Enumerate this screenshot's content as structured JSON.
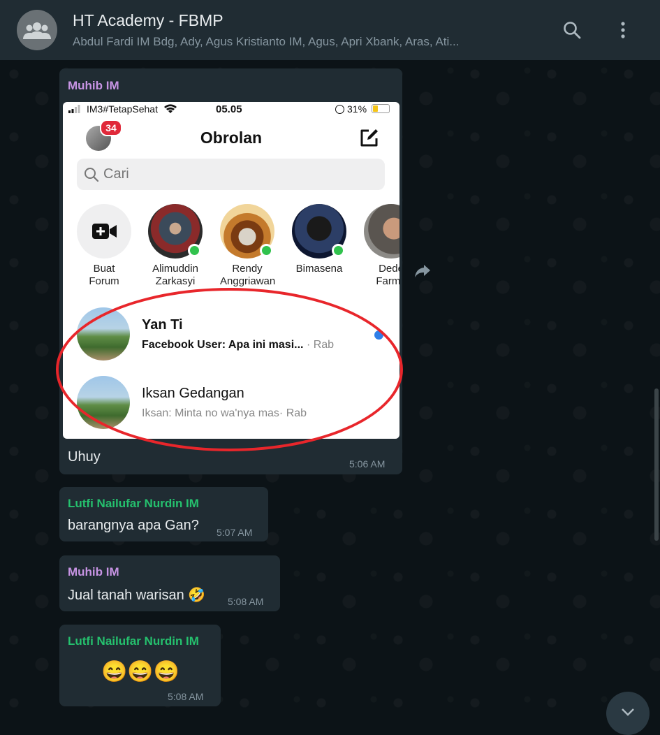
{
  "header": {
    "title": "HT Academy - FBMP",
    "subtitle": "Abdul Fardi IM Bdg, Ady, Agus Kristianto IM, Agus, Apri Xbank, Aras, Ati...",
    "icons": [
      "group-avatar-icon",
      "search-icon",
      "menu-dots-icon"
    ]
  },
  "messages": [
    {
      "sender": "Muhib IM",
      "image": {
        "status_bar": {
          "carrier": "IM3#TetapSehat",
          "time": "05.05",
          "battery": "31%"
        },
        "app_title": "Obrolan",
        "avatar_badge": "34",
        "search_placeholder": "Cari",
        "stories": [
          {
            "line1": "Buat",
            "line2": "Forum"
          },
          {
            "line1": "Alimuddin",
            "line2": "Zarkasyi"
          },
          {
            "line1": "Rendy",
            "line2": "Anggriawan"
          },
          {
            "line1": "Bimasena",
            "line2": ""
          },
          {
            "line1": "Dede",
            "line2": "Farmu"
          }
        ],
        "conversations": [
          {
            "name": "Yan Ti",
            "snippet": "Facebook User: Apa ini masi...",
            "time": "· Rab",
            "unread": true
          },
          {
            "name": "Iksan Gedangan",
            "snippet": "Iksan: Minta no wa'nya mas",
            "time": "· Rab",
            "unread": false
          }
        ]
      },
      "text": "Uhuy",
      "time": "5:06 AM"
    },
    {
      "sender": "Lutfi Nailufar Nurdin IM",
      "text": "barangnya apa Gan?",
      "time": "5:07 AM"
    },
    {
      "sender": "Muhib IM",
      "text": "Jual tanah warisan 🤣",
      "time": "5:08 AM"
    },
    {
      "sender": "Lutfi Nailufar Nurdin IM",
      "text": "😄😄😄",
      "time": "5:08 AM"
    }
  ],
  "colors": {
    "header_bg": "#202c33",
    "bubble_bg": "#202c33",
    "sender_purple": "#c794e4",
    "sender_green": "#25c16e",
    "highlight_oval": "#e8262b"
  }
}
